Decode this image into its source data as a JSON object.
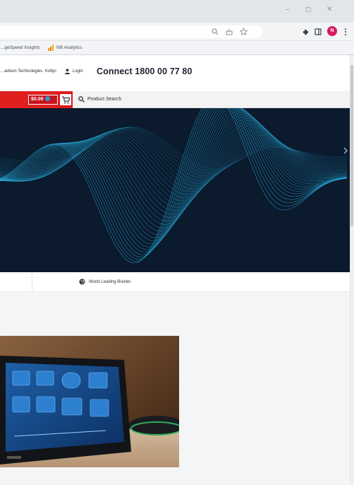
{
  "window": {
    "min_glyph": "‒",
    "restore_glyph": "◻",
    "close_glyph": "✕"
  },
  "toolbar": {
    "profile_initial": "N"
  },
  "bookmarks": [
    {
      "label": "…geSpeed Insights"
    },
    {
      "label": "NB Analytics"
    }
  ],
  "header": {
    "top_links": [
      "…adison Technologies",
      "Kollyc"
    ],
    "login": "Login",
    "connect": "Connect 1800 00 77 80"
  },
  "cart": {
    "price": "$0.00"
  },
  "search": {
    "label": "Product Search"
  },
  "features": {
    "brands": "World Leading Brands"
  },
  "colors": {
    "brand_red": "#e0201f",
    "hero_bg": "#0b1a2d",
    "wave": "#29b6e8"
  },
  "icons": [
    "zoom-icon",
    "share-icon",
    "star-icon",
    "extensions-icon",
    "sidepanel-icon",
    "profile-icon",
    "menu-icon",
    "chart-icon",
    "user-icon",
    "cart-icon",
    "search-icon",
    "globe-icon",
    "chevron-right-icon"
  ]
}
